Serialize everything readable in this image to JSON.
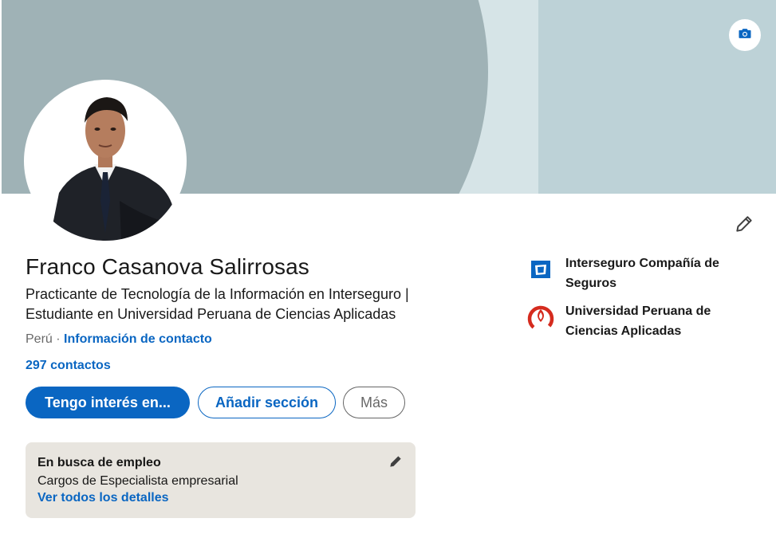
{
  "profile": {
    "name": "Franco Casanova Salirrosas",
    "headline": "Practicante de Tecnología de la Información en Interseguro | Estudiante en Universidad Peruana de Ciencias Aplicadas",
    "location": "Perú",
    "location_separator": " · ",
    "contact_info_link": "Información de contacto",
    "connections": "297 contactos"
  },
  "actions": {
    "open_to": "Tengo interés en...",
    "add_section": "Añadir sección",
    "more": "Más"
  },
  "open_to_work": {
    "title": "En busca de empleo",
    "roles": "Cargos de Especialista empresarial",
    "details_link": "Ver todos los detalles"
  },
  "organizations": [
    {
      "name": "Interseguro Compañía de Seguros",
      "logo": "interseguro-logo"
    },
    {
      "name": "Universidad Peruana de Ciencias Aplicadas",
      "logo": "upc-logo"
    }
  ],
  "icons": {
    "banner_camera": "camera-icon",
    "edit_intro": "pencil-icon",
    "edit_open_to_work": "pencil-icon"
  },
  "colors": {
    "accent": "#0a66c2",
    "banner_light": "#bdd2d7",
    "banner_dark": "#9fb2b6",
    "open_to_work_bg": "#e8e5df",
    "upc_red": "#d52b1e"
  }
}
